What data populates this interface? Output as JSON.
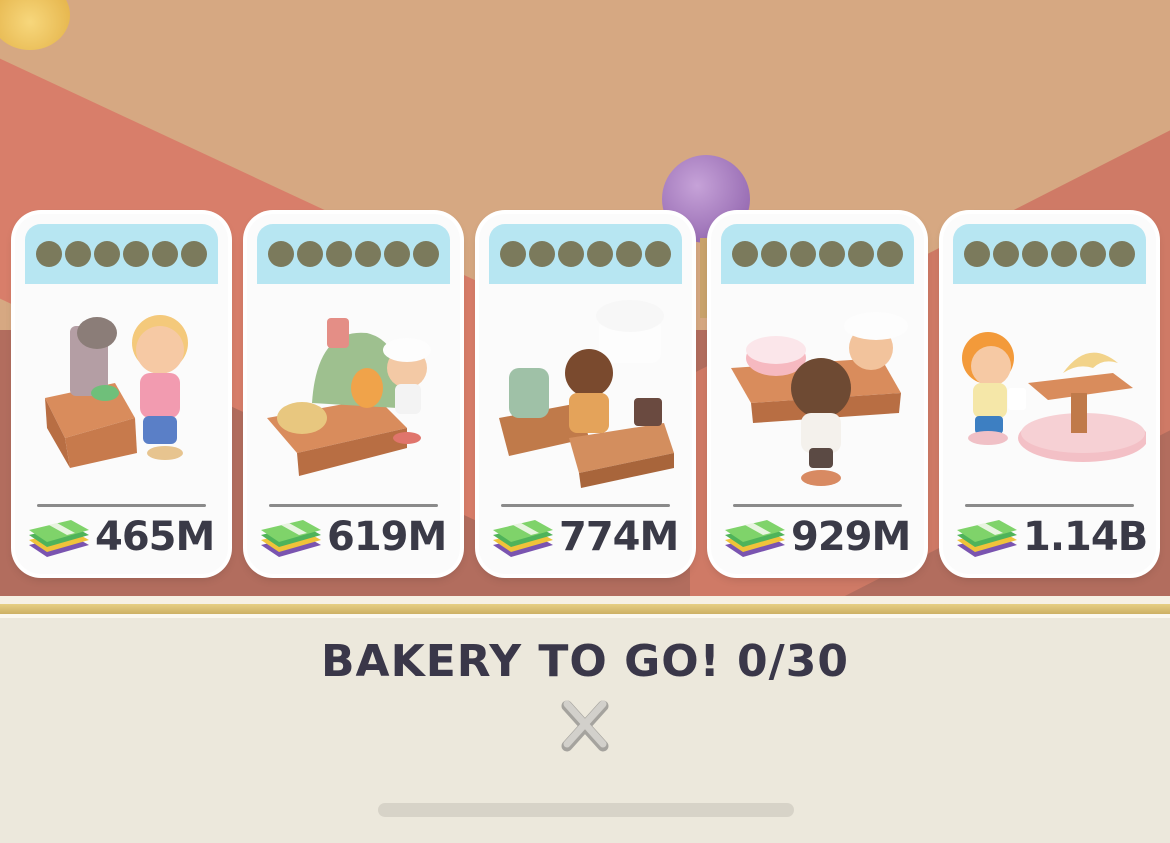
{
  "cards": [
    {
      "name": "coffee-station",
      "price": "465M"
    },
    {
      "name": "pizza-oven",
      "price": "619M"
    },
    {
      "name": "espresso-counter",
      "price": "774M"
    },
    {
      "name": "cake-counter",
      "price": "929M"
    },
    {
      "name": "croissant-table",
      "price": "1.14B"
    }
  ],
  "level_dots_per_card": 6,
  "currency_icon": "cash-stack-icon",
  "panel": {
    "title": "BAKERY TO GO! 0/30",
    "close_icon": "close-x-icon"
  },
  "colors": {
    "card_header": "#b7e6f2",
    "dot": "#7b7a5c",
    "price_text": "#3a3a47",
    "panel_bg": "#ece8dc",
    "panel_trim": "#d9bf72"
  }
}
